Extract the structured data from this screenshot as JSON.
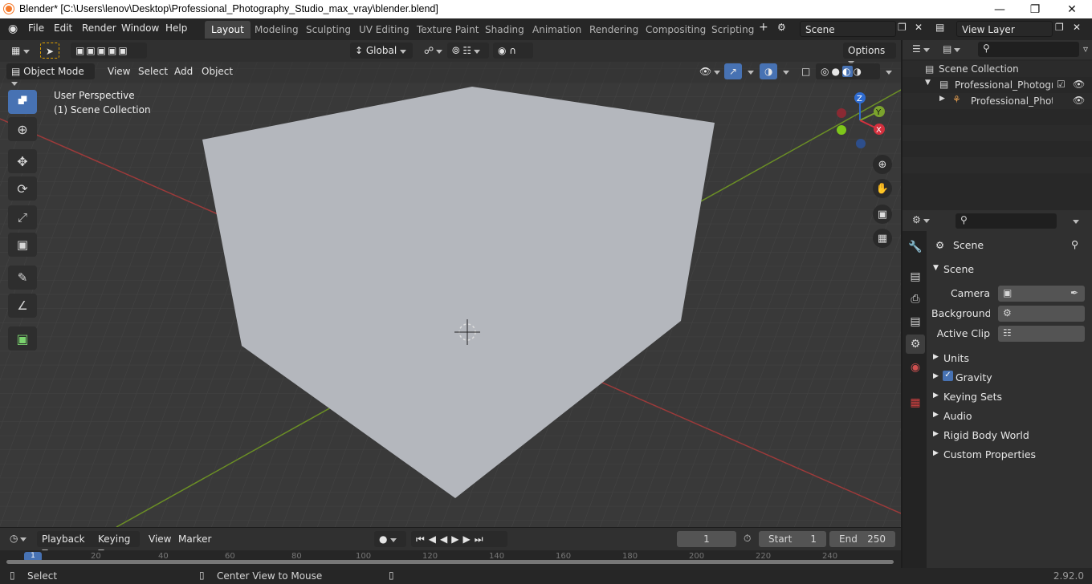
{
  "window": {
    "title": "Blender* [C:\\Users\\lenov\\Desktop\\Professional_Photography_Studio_max_vray\\blender.blend]"
  },
  "menus": [
    "File",
    "Edit",
    "Render",
    "Window",
    "Help"
  ],
  "workspaces": [
    {
      "label": "Layout",
      "active": true
    },
    {
      "label": "Modeling"
    },
    {
      "label": "Sculpting"
    },
    {
      "label": "UV Editing"
    },
    {
      "label": "Texture Paint"
    },
    {
      "label": "Shading"
    },
    {
      "label": "Animation"
    },
    {
      "label": "Rendering"
    },
    {
      "label": "Compositing"
    },
    {
      "label": "Scripting"
    }
  ],
  "scene_field": "Scene",
  "view_layer_field": "View Layer",
  "tool_header": {
    "orientation": "Global",
    "options": "Options"
  },
  "viewport_header": {
    "mode": "Object Mode",
    "menus": [
      "View",
      "Select",
      "Add",
      "Object"
    ]
  },
  "viewport_overlay": {
    "perspective": "User Perspective",
    "collection": "(1) Scene Collection"
  },
  "gizmo": {
    "x": "X",
    "y": "Y",
    "z": "Z"
  },
  "outliner": {
    "root": "Scene Collection",
    "items": [
      "Professional_Photography",
      "Professional_Photogr"
    ]
  },
  "properties": {
    "context": "Scene",
    "panel": "Scene",
    "fields": [
      {
        "label": "Camera"
      },
      {
        "label": "Background ..."
      },
      {
        "label": "Active Clip"
      }
    ],
    "sections": [
      "Units",
      "Gravity",
      "Keying Sets",
      "Audio",
      "Rigid Body World",
      "Custom Properties"
    ]
  },
  "timeline": {
    "menus": [
      "Playback",
      "Keying",
      "View",
      "Marker"
    ],
    "current_frame": "1",
    "start_label": "Start",
    "start": "1",
    "end_label": "End",
    "end": "250",
    "ruler": [
      "1",
      "20",
      "40",
      "60",
      "80",
      "100",
      "120",
      "140",
      "160",
      "180",
      "200",
      "220",
      "240"
    ]
  },
  "status_bar": {
    "select": "Select",
    "center": "Center View to Mouse",
    "version": "2.92.0"
  },
  "colors": {
    "accent": "#4772b3",
    "viewport_bg": "#393939",
    "cube": "#b4b7bd",
    "x_axis": "#9c3a3a",
    "y_axis": "#6b8f25"
  }
}
